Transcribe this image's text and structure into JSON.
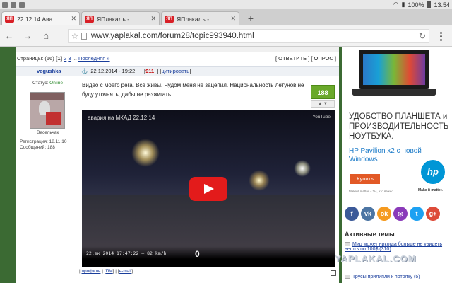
{
  "status_bar": {
    "battery": "100%",
    "time": "13:54"
  },
  "tabs": [
    {
      "favicon": "ЯП",
      "title": "22.12.14 Ава",
      "active": true
    },
    {
      "favicon": "ЯП",
      "title": "ЯПлакалъ -",
      "active": false
    },
    {
      "favicon": "ЯП",
      "title": "ЯПлакалъ -",
      "active": false
    }
  ],
  "new_tab_label": "+",
  "address_bar": {
    "url": "www.yaplakal.com/forum28/topic993940.html"
  },
  "pager": {
    "pages_label": "Страницы:",
    "count": "(16)",
    "current": "[1]",
    "p2": "2",
    "p3": "3",
    "ellipsis": "...",
    "last": "Последняя »"
  },
  "actions": {
    "reply": "[ ОТВЕТИТЬ ]",
    "poll": "[ ОПРОС ]"
  },
  "post": {
    "author": "vegushka",
    "date": "22.12.2014 - 19:22",
    "number": "911",
    "quote": "цитировать",
    "status_label": "Статус:",
    "status_value": "Online",
    "rank": "Весельчак",
    "reg_label": "Регистрация: 18.11.10",
    "msgs_label": "Сообщений: 188",
    "text": "Видео с моего рега. Все живы. Чудом меня не зацепил. Национальность летунов не буду уточнять, дабы не разжигать.",
    "rating": "188",
    "footer_profile": "профиль",
    "footer_pm": "ПМ",
    "footer_email": "e-mail"
  },
  "video": {
    "title": "авария на МКАД 22.12.14",
    "provider": "YouTube",
    "timestamp": "22.ек 2014  17:47:22 — 82 km/h",
    "speed": "0"
  },
  "ad": {
    "headline": "УДОБСТВО ПЛАНШЕТА и ПРОИЗВОДИТЕЛЬНОСТЬ НОУТБУКА.",
    "product": "HP Pavilion x2 с новой Windows",
    "buy": "Купить",
    "fine_print": "Make it matter = Ты, что важно.",
    "brand": "hp",
    "tagline": "Make it matter."
  },
  "social_icons": [
    {
      "name": "facebook-icon",
      "glyph": "f",
      "color": "#3b5998"
    },
    {
      "name": "vk-icon",
      "glyph": "vk",
      "color": "#4c75a3"
    },
    {
      "name": "odnoklassniki-icon",
      "glyph": "ok",
      "color": "#f59a1f"
    },
    {
      "name": "instagram-icon",
      "glyph": "◎",
      "color": "#8a3ab9"
    },
    {
      "name": "twitter-icon",
      "glyph": "t",
      "color": "#1da1f2"
    },
    {
      "name": "google-plus-icon",
      "glyph": "g+",
      "color": "#dd4b39"
    }
  ],
  "active_topics": {
    "title": "Активные темы",
    "items": [
      {
        "text": "Мир может никогда больше не увидеть нефть по 100$ (310)"
      },
      {
        "text": "Трусы прилипли к потолку (5)"
      }
    ]
  },
  "watermark": "YAPLAKAL.COM"
}
